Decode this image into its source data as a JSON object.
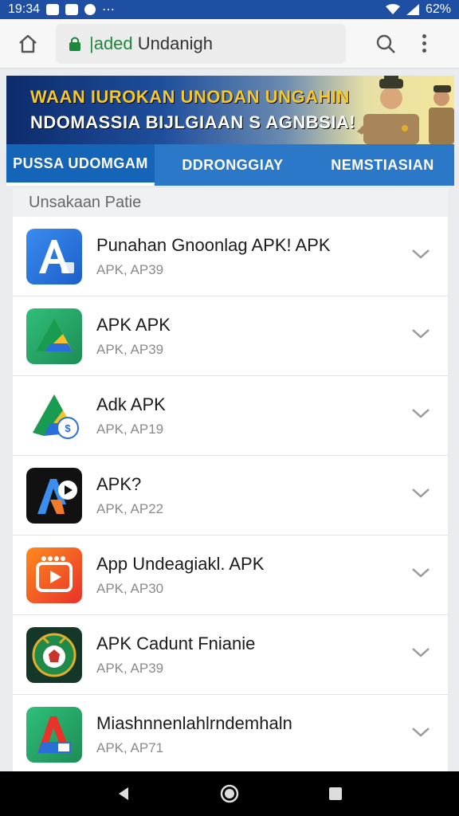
{
  "status_bar": {
    "time": "19:34",
    "battery": "62%"
  },
  "browser": {
    "url_prefix": "|aded",
    "url_rest": "Undanigh"
  },
  "banner": {
    "line1": "WAAN IUROKAN UNODAN UNGAHIN",
    "line2": "NDOMASSIA BIJLGIAAN S AGNBSIA!"
  },
  "tabs": [
    {
      "label": "PUSSA UDOMGAM",
      "active": true
    },
    {
      "label": "DDRONGGIAY",
      "active": false
    },
    {
      "label": "NEMSTIASIAN",
      "active": false
    }
  ],
  "list": {
    "header": "Unsakaan Patie",
    "items": [
      {
        "title": "Punahan Gnoonlag APK! APK",
        "sub": "APK, AP39",
        "icon": "app-a-blue-icon"
      },
      {
        "title": "APK APK",
        "sub": "APK, AP39",
        "icon": "drive-triangle-icon"
      },
      {
        "title": "Adk APK",
        "sub": "APK, AP19",
        "icon": "drive-badge-icon"
      },
      {
        "title": "APK?",
        "sub": "APK, AP22",
        "icon": "app-a-dark-icon"
      },
      {
        "title": "App Undeagiakl. APK",
        "sub": "APK, AP30",
        "icon": "video-play-icon"
      },
      {
        "title": "APK Cadunt Fnianie",
        "sub": "APK, AP39",
        "icon": "emblem-icon"
      },
      {
        "title": "Miashnnenlahlrndemhaln",
        "sub": "APK, AP71",
        "icon": "app-a-green-icon"
      }
    ]
  },
  "colors": {
    "status_bar": "#1e4fa3",
    "tab_bar": "#2b78c8",
    "banner_yellow": "#f7c82a"
  }
}
